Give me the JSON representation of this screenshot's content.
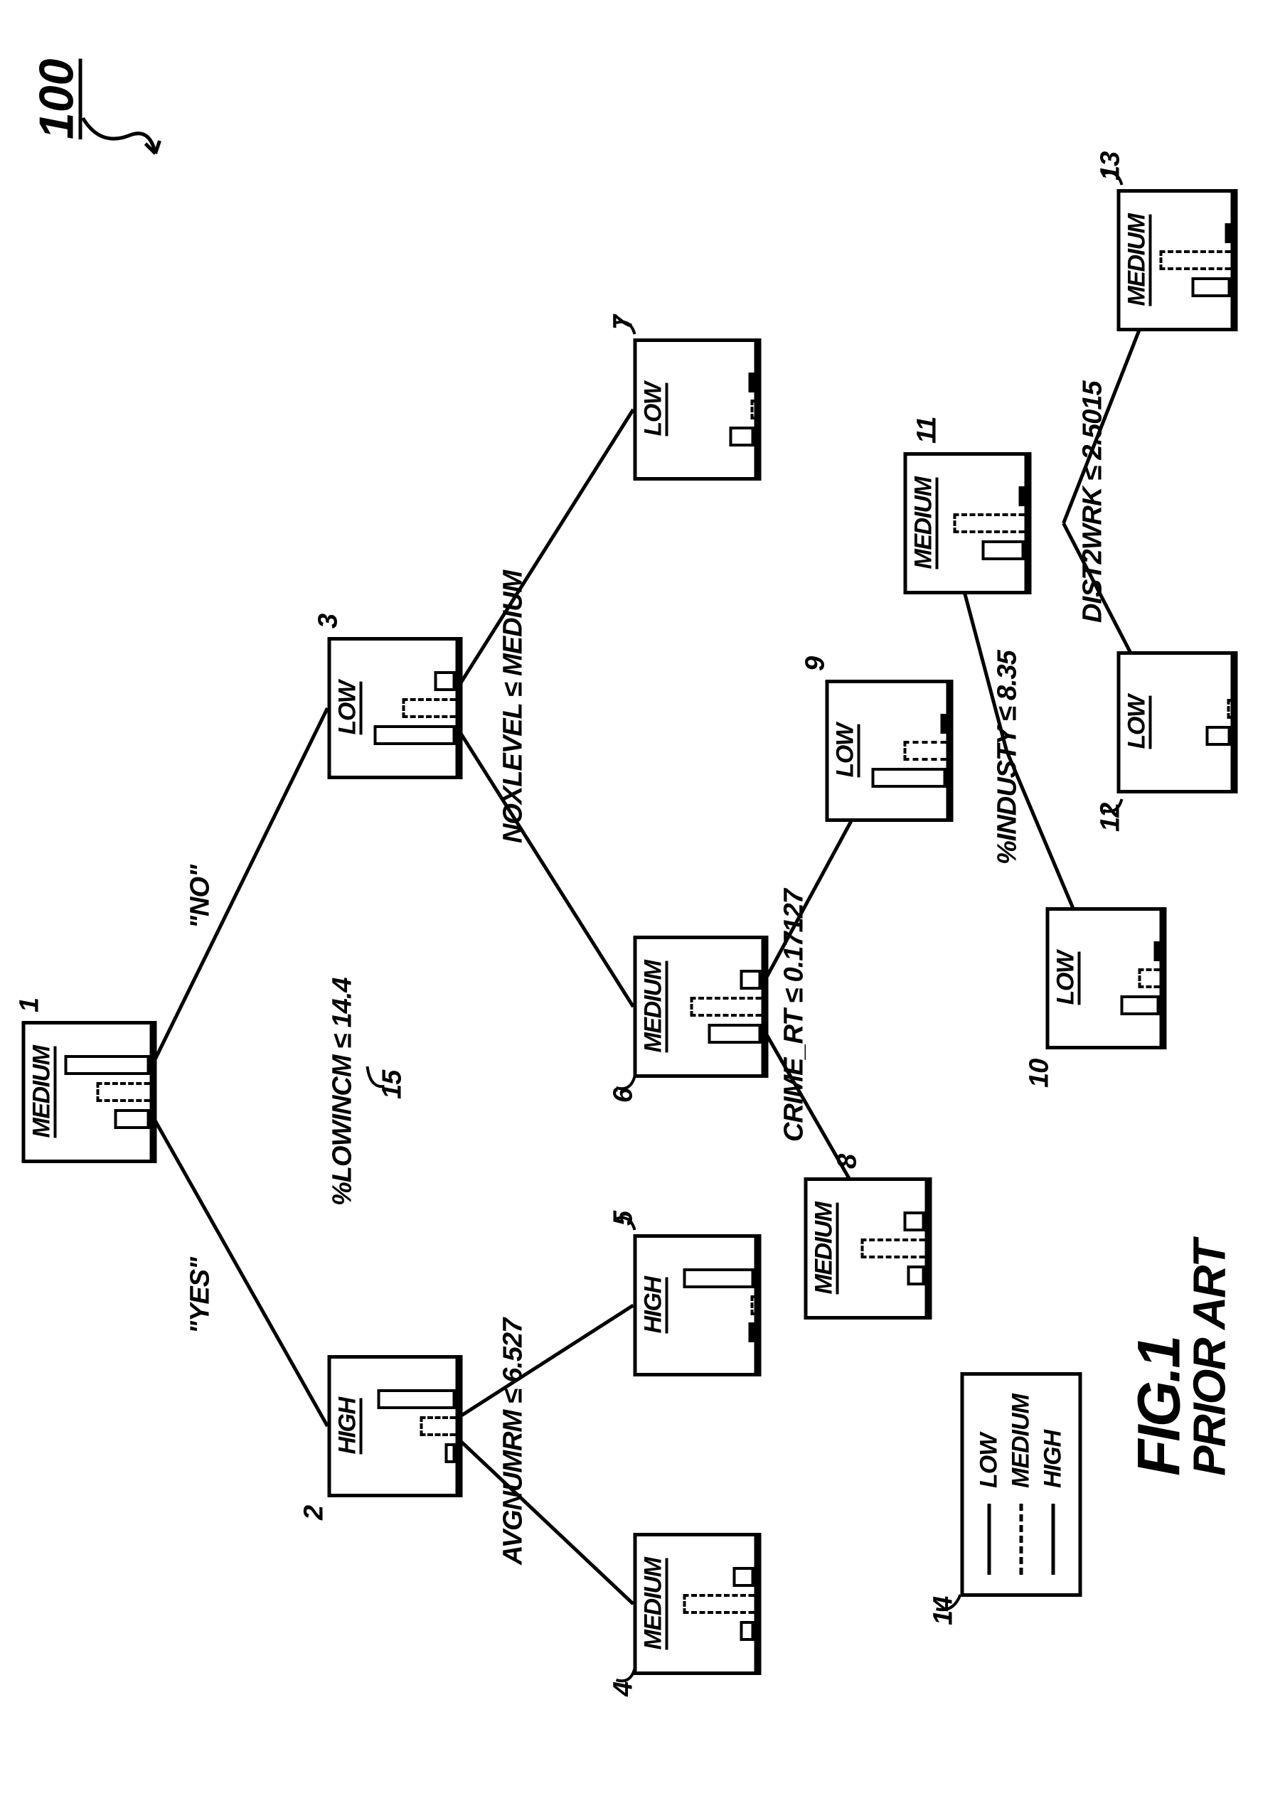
{
  "ref100": "100",
  "yes": "\"YES\"",
  "no": "\"NO\"",
  "nodes": {
    "n1": {
      "id": "1",
      "label": "MEDIUM",
      "bars": [
        50,
        75,
        120
      ]
    },
    "n2": {
      "id": "2",
      "label": "HIGH",
      "bars": [
        15,
        50,
        110
      ]
    },
    "n3": {
      "id": "3",
      "label": "LOW",
      "bars": [
        115,
        75,
        30
      ]
    },
    "n4": {
      "id": "4",
      "label": "MEDIUM",
      "bars": [
        20,
        100,
        30
      ]
    },
    "n5": {
      "id": "5",
      "label": "HIGH",
      "bars": [
        5,
        5,
        100
      ]
    },
    "n6": {
      "id": "6",
      "label": "MEDIUM",
      "bars": [
        75,
        100,
        30
      ]
    },
    "n7": {
      "id": "7",
      "label": "LOW",
      "bars": [
        35,
        5,
        5
      ]
    },
    "n8": {
      "id": "8",
      "label": "MEDIUM",
      "bars": [
        25,
        90,
        30
      ]
    },
    "n9": {
      "id": "9",
      "label": "LOW",
      "bars": [
        105,
        60,
        5
      ]
    },
    "n10": {
      "id": "10",
      "label": "LOW",
      "bars": [
        55,
        30,
        5
      ]
    },
    "n11": {
      "id": "11",
      "label": "MEDIUM",
      "bars": [
        60,
        100,
        5
      ]
    },
    "n12": {
      "id": "12",
      "label": "LOW",
      "bars": [
        35,
        5,
        0
      ]
    },
    "n13": {
      "id": "13",
      "label": "MEDIUM",
      "bars": [
        55,
        100,
        5
      ]
    }
  },
  "splits": {
    "s15": {
      "id": "15",
      "text": "%LOWINCM ≤ 14.4"
    },
    "s2": {
      "text": "AVGNUMRM ≤ 6.527"
    },
    "s3": {
      "text": "NOXLEVEL ≤ MEDIUM"
    },
    "s6": {
      "text": "CRIME_RT ≤ 0.17127"
    },
    "s9": {
      "text": "%INDUSTY ≤ 8.35"
    },
    "s11": {
      "text": "DIST2WRK ≤ 2.5015"
    }
  },
  "legend": {
    "id": "14",
    "items": [
      {
        "style": "solid",
        "label": "LOW"
      },
      {
        "style": "dashed",
        "label": "MEDIUM"
      },
      {
        "style": "solid",
        "label": "HIGH"
      }
    ]
  },
  "figure": {
    "line1": "FIG.1",
    "line2": "PRIOR ART"
  }
}
